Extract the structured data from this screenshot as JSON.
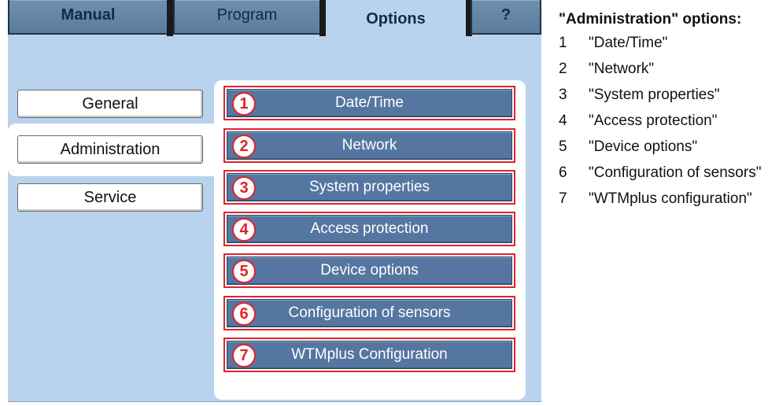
{
  "tabs": {
    "manual": "Manual",
    "program": "Program",
    "options": "Options",
    "help": "?"
  },
  "sidebar": {
    "items": [
      {
        "label": "General"
      },
      {
        "label": "Administration"
      },
      {
        "label": "Service"
      }
    ]
  },
  "options": [
    {
      "number": "1",
      "label": "Date/Time"
    },
    {
      "number": "2",
      "label": "Network"
    },
    {
      "number": "3",
      "label": "System properties"
    },
    {
      "number": "4",
      "label": "Access protection"
    },
    {
      "number": "5",
      "label": "Device options"
    },
    {
      "number": "6",
      "label": "Configuration of sensors"
    },
    {
      "number": "7",
      "label": "WTMplus Configuration"
    }
  ],
  "legend": {
    "title": "\"Administration\" options:",
    "items": [
      {
        "number": "1",
        "text": "\"Date/Time\""
      },
      {
        "number": "2",
        "text": "\"Network\""
      },
      {
        "number": "3",
        "text": "\"System properties\""
      },
      {
        "number": "4",
        "text": "\"Access protection\""
      },
      {
        "number": "5",
        "text": "\"Device options\""
      },
      {
        "number": "6",
        "text": "\"Configuration of sensors\""
      },
      {
        "number": "7",
        "text": "\"WTMplus configuration\""
      }
    ]
  },
  "colors": {
    "screen_bg": "#b9d3ee",
    "button_blue": "#5576a0",
    "callout_red": "#e0242a",
    "tab_text": "#0e2c4a"
  }
}
